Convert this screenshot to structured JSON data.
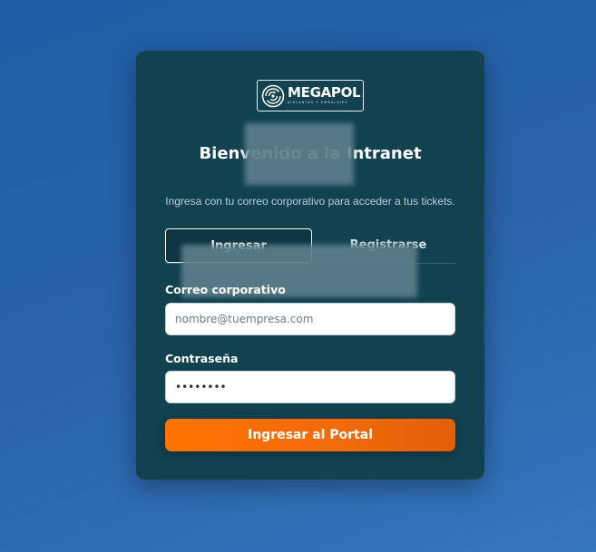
{
  "logo": {
    "name": "MEGAPOL",
    "tagline": "AISLANTES Y EMBALAJES"
  },
  "header": {
    "title": "Bienvenido a la Intranet",
    "subtitle": "Ingresa con tu correo corporativo para acceder a tus tickets."
  },
  "tabs": [
    {
      "label": "Ingresar",
      "active": true
    },
    {
      "label": "Registrarse",
      "active": false
    }
  ],
  "form": {
    "email_label": "Correo corporativo",
    "email_placeholder": "nombre@tuempresa.com",
    "password_label": "Contraseña",
    "password_value": "12345678",
    "submit_label": "Ingresar al Portal"
  },
  "colors": {
    "background": "#2a62a8",
    "card": "#12414f",
    "accent": "#ff7300"
  }
}
